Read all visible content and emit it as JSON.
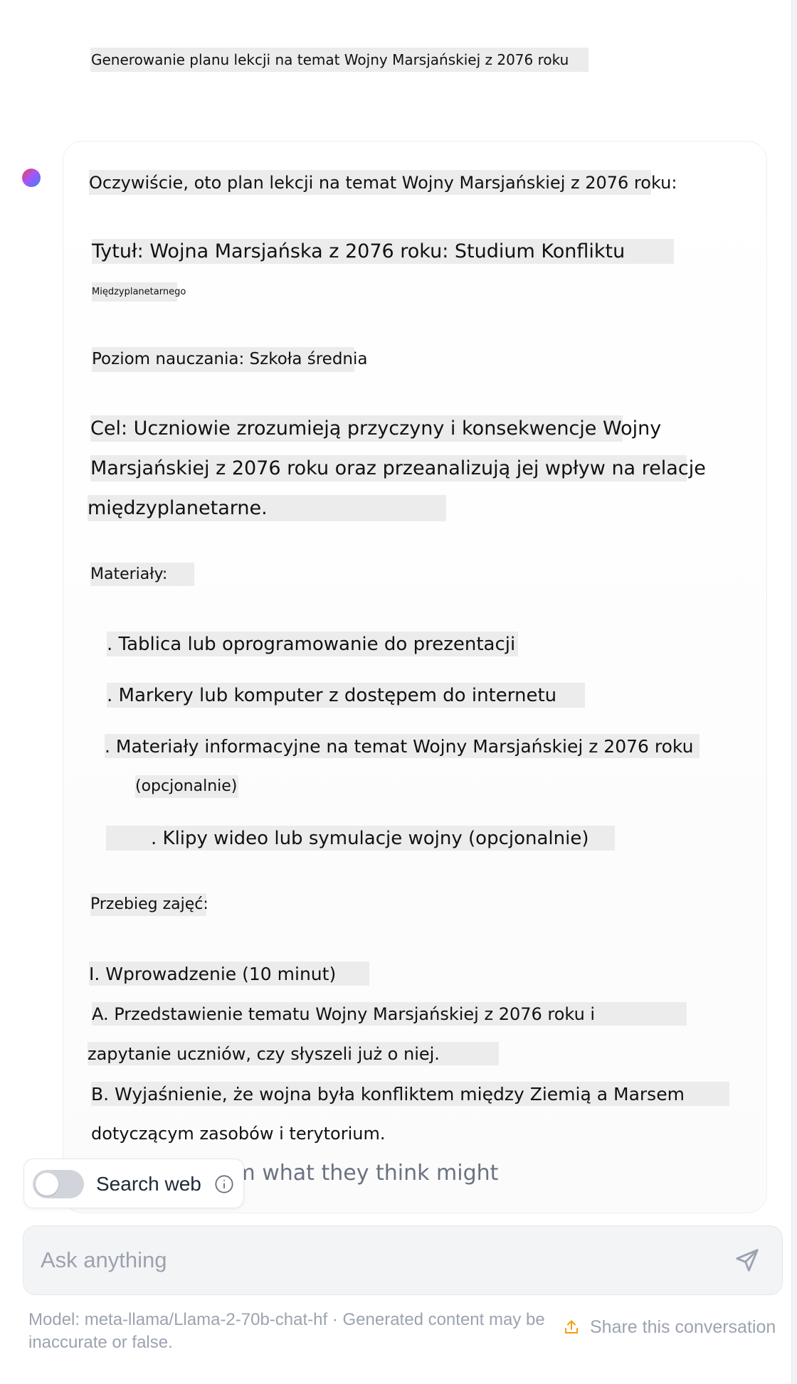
{
  "conversation": {
    "user_message": "Generowanie planu lekcji na temat Wojny Marsjańskiej z 2076 roku",
    "assistant": {
      "intro": "Oczywiście, oto plan lekcji na temat Wojny Marsjańskiej z 2076 roku:",
      "title_line1": "Tytuł: Wojna Marsjańska z 2076 roku: Studium Konfliktu",
      "title_line2": "Międzyplanetarnego",
      "level": "Poziom nauczania: Szkoła średnia",
      "goal_line1": "Cel: Uczniowie zrozumieją przyczyny i konsekwencje Wojny",
      "goal_line2": "Marsjańskiej z 2076 roku oraz przeanalizują jej wpływ na relacje",
      "goal_line3": "międzyplanetarne.",
      "materials_heading": "Materiały:",
      "materials": [
        ". Tablica lub oprogramowanie do prezentacji",
        ". Markery lub komputer z dostępem do internetu",
        ". Materiały informacyjne na temat Wojny Marsjańskiej z 2076 roku",
        "(opcjonalnie)",
        ". Klipy wideo lub symulacje wojny (opcjonalnie)"
      ],
      "course_heading": "Przebieg zajęć:",
      "section1": "I. Wprowadzenie (10 minut)",
      "a_line1": "A. Przedstawienie tematu Wojny Marsjańskiej z 2076 roku i",
      "a_line2": "zapytanie uczniów, czy słyszeli już o niej.",
      "b_line1": "B. Wyjaśnienie, że wojna była konfliktem między Ziemią a Marsem",
      "b_line2": "dotyczącym zasobów i terytorium.",
      "faded_partial": "s to brainstorm what they think might"
    }
  },
  "search_web": {
    "label": "Search web",
    "enabled": false,
    "icon": "info-icon"
  },
  "input": {
    "placeholder": "Ask anything",
    "value": "",
    "send_icon": "send-icon"
  },
  "footer": {
    "model_text": "Model: meta-llama/Llama-2-70b-chat-hf · Generated content may be inaccurate or false.",
    "share_label": "Share this conversation",
    "share_icon": "share-icon"
  },
  "colors": {
    "avatar_gradient": [
      "#ef4444",
      "#a855f7",
      "#3b82f6"
    ],
    "highlight": "#ececec",
    "share_accent": "#f59e0b",
    "muted_text": "#9ca3af"
  }
}
